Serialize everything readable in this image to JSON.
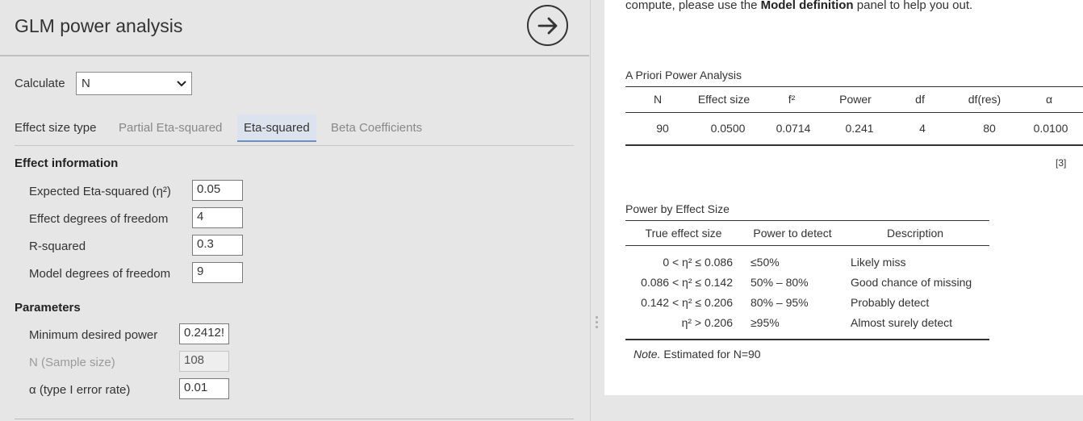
{
  "analysis": {
    "title": "GLM power analysis",
    "calculate_label": "Calculate",
    "calculate_value": "N",
    "effect_size_type_label": "Effect size type",
    "tabs": [
      {
        "label": "Partial Eta-squared",
        "active": false
      },
      {
        "label": "Eta-squared",
        "active": true
      },
      {
        "label": "Beta Coefficients",
        "active": false
      }
    ],
    "effect_info": {
      "heading": "Effect information",
      "fields": [
        {
          "label": "Expected Eta-squared (η²)",
          "value": "0.05"
        },
        {
          "label": "Effect degrees of freedom",
          "value": "4"
        },
        {
          "label": "R-squared",
          "value": "0.3"
        },
        {
          "label": "Model degrees of freedom",
          "value": "9"
        }
      ]
    },
    "parameters": {
      "heading": "Parameters",
      "fields": [
        {
          "label": "Minimum desired power",
          "value": "0.2412!",
          "disabled": false
        },
        {
          "label": "N (Sample size)",
          "value": "108",
          "disabled": true
        },
        {
          "label": "α (type I error rate)",
          "value": "0.01",
          "disabled": false
        }
      ]
    }
  },
  "results": {
    "intro_pre": "compute, please use the ",
    "intro_bold": "Model definition",
    "intro_post": " panel to help you out.",
    "apriori": {
      "title": "A Priori Power Analysis",
      "headers": [
        "N",
        "Effect size",
        "f²",
        "Power",
        "df",
        "df(res)",
        "α"
      ],
      "row": [
        "90",
        "0.0500",
        "0.0714",
        "0.241",
        "4",
        "80",
        "0.0100"
      ],
      "footnote": "[3]"
    },
    "by_effect": {
      "title": "Power by Effect Size",
      "headers": [
        "True effect size",
        "Power to detect",
        "Description"
      ],
      "rows": [
        [
          "0 < η² ≤ 0.086",
          "≤50%",
          "Likely miss"
        ],
        [
          "0.086 < η² ≤ 0.142",
          "50% – 80%",
          "Good chance of missing"
        ],
        [
          "0.142 < η² ≤ 0.206",
          "80% – 95%",
          "Probably detect"
        ],
        [
          "η² > 0.206",
          "≥95%",
          "Almost surely detect"
        ]
      ],
      "note_label": "Note.",
      "note_text": " Estimated for N=90"
    }
  }
}
